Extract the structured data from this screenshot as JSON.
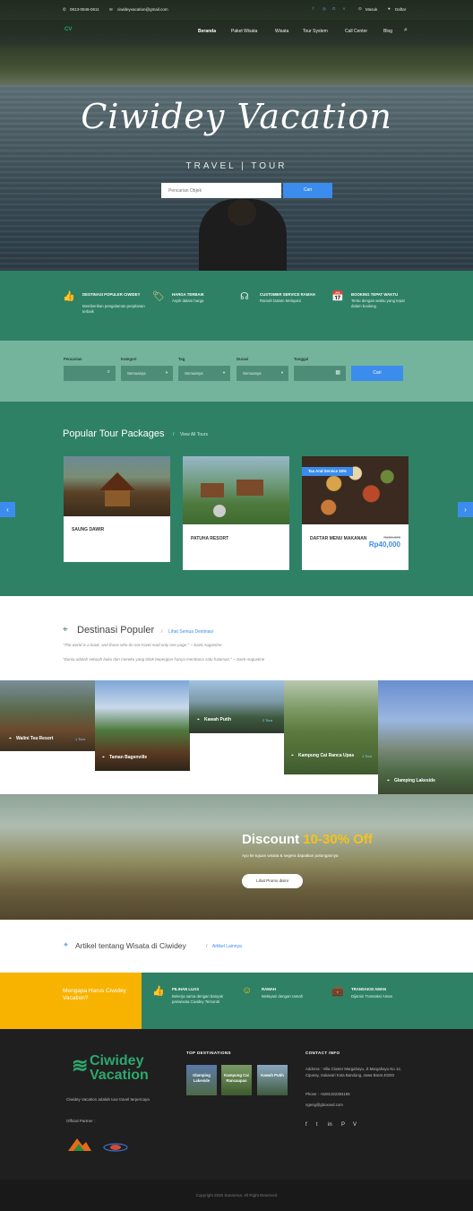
{
  "topbar": {
    "phone": "0813-0846-0611",
    "email": "ciwideyvacation@gmail.com",
    "register": "Daftar",
    "login": "Masuk"
  },
  "nav": {
    "logo": "CV",
    "items": [
      "Beranda",
      "Paket Wisata",
      "Wisata",
      "Tour System",
      "Call Center",
      "Blog"
    ]
  },
  "hero": {
    "title": "Ciwidey Vacation",
    "subtitle": "TRAVEL | TOUR",
    "search_placeholder": "Pencarian Objek",
    "search_button": "Cari"
  },
  "features": [
    {
      "icon": "thumbs-up-icon",
      "title": "DESTINASI POPULER CIWIDEY",
      "desc": "Memberikan pengalaman perjalanan terbaik"
    },
    {
      "icon": "price-tag-icon",
      "title": "HARGA TERBAIK",
      "desc": "Asyik dalam harga"
    },
    {
      "icon": "support-icon",
      "title": "CUSTOMER SERVICE RAMAH",
      "desc": "Ramah Dalam Melayani"
    },
    {
      "icon": "calendar-icon",
      "title": "BOOKING TEPAT WAKTU",
      "desc": "Tentu dengan waktu yang tepat dalam booking"
    }
  ],
  "filter": {
    "fields": [
      {
        "label": "Pencarian",
        "value": ""
      },
      {
        "label": "Kategori",
        "value": "Semuanya"
      },
      {
        "label": "Tag",
        "value": "Semuanya"
      },
      {
        "label": "Durasi",
        "value": "Semuanya"
      },
      {
        "label": "Tanggal",
        "value": ""
      }
    ],
    "button": "Cari"
  },
  "tours": {
    "title": "Popular Tour Packages",
    "link": "View All Tours",
    "cards": [
      {
        "name": "SAUNG DAWIR",
        "badge": "",
        "old_price": "",
        "price": ""
      },
      {
        "name": "PATUHA RESORT",
        "badge": "",
        "old_price": "",
        "price": ""
      },
      {
        "name": "DAFTAR MENU MAKANAN",
        "badge": "Tax And Service 15%",
        "old_price": "Rp50,000",
        "price": "Rp40,000"
      }
    ]
  },
  "destinations": {
    "title": "Destinasi Populer",
    "link": "Lihat Semua Destinasi",
    "quote1": "\"The world is a book, and those who do not travel read only one page.\" ~ Saint Augustine",
    "quote2": "\"Dunia adalah sebuah buku dan mereka yang tidak bepergian hanya membaca satu halaman.\" ~ Saint Augustine",
    "items": [
      {
        "name": "Walini Tea Resort",
        "count": "1 Tour"
      },
      {
        "name": "Taman Bagenville",
        "count": ""
      },
      {
        "name": "Kawah Putih",
        "count": "2 Tour"
      },
      {
        "name": "Kampung Cai Ranca Upas",
        "count": "1 Tour"
      },
      {
        "name": "Glamping Lakeside",
        "count": ""
      }
    ]
  },
  "discount": {
    "title": "Discount ",
    "highlight": "10-30% Off",
    "sub": "Ayo ke tujuan wisata & segera dapatkan potongannya",
    "button": "Lihat Promo disini"
  },
  "articles": {
    "title": "Artikel tentang Wisata di Ciwidey",
    "link": "Artikel Lainnya"
  },
  "why": {
    "title": "Mengapa Harus Ciwidey Vacation?",
    "items": [
      {
        "icon": "thumbs-up-icon",
        "title": "PILIHAN LUAS",
        "desc": "Bekerja sama dengan banyak pariwisata Ciwidey Tersoroti"
      },
      {
        "icon": "smile-icon",
        "title": "RAMAH",
        "desc": "Melayani dengan ramah"
      },
      {
        "icon": "briefcase-icon",
        "title": "TRANSAKSI AMAN",
        "desc": "Dijamin Transaksi Aman"
      }
    ]
  },
  "footer": {
    "logo_line1": "Ciwidey",
    "logo_line2": "Vacation",
    "desc": "Ciwidey Vacation adalah tour travel terpercaya",
    "partners_label": "Official Partner :",
    "top_dest_title": "TOP DESTINATIONS",
    "top_dest": [
      "Glamping Lakeside",
      "Kampung Cai Rancaupas",
      "Kawah Putih"
    ],
    "contact_title": "CONTACT INFO",
    "address": "Address : Villa Cluster Margahayu, Jl.Margahayu No 12, Ciparay, Sukasari Kota Bandung, Jawa Barat 40283",
    "phone": "Phone : +6281322384196",
    "email": "ngeng@gboxxed.com",
    "copyright": "Copyright 2020 Sanarena. All Right Reserved"
  },
  "colors": {
    "green": "#2f8166",
    "light_green": "#75b49c",
    "blue": "#3b8ced",
    "yellow": "#f8b300"
  }
}
